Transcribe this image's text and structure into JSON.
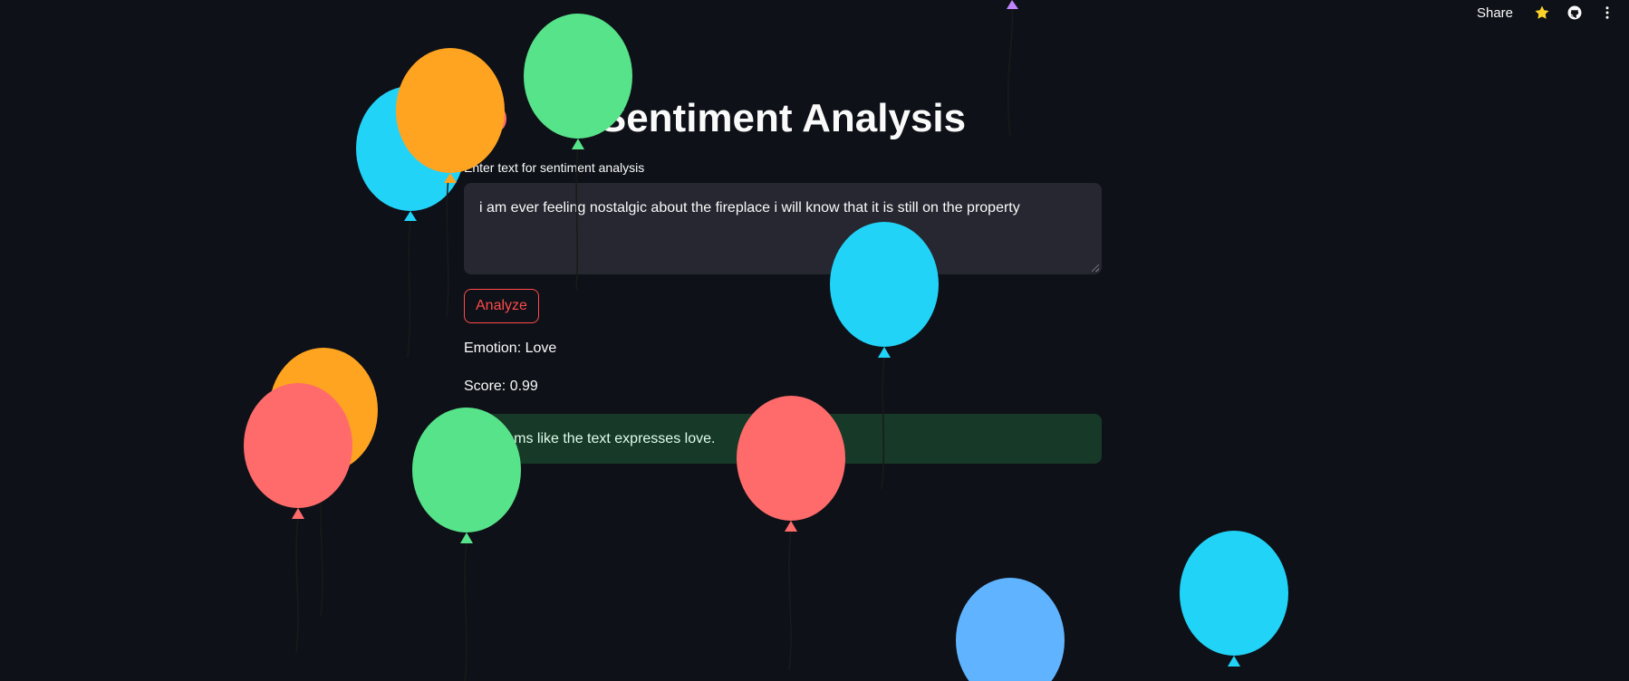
{
  "toolbar": {
    "share_label": "Share",
    "star_icon": "star-icon",
    "github_icon": "github-icon",
    "menu_icon": "more-vertical-icon"
  },
  "main": {
    "title": "Sentiment Analysis",
    "input_label": "Enter text for sentiment analysis",
    "input_value": "i am ever feeling nostalgic about the fireplace i will know that it is still on the property",
    "analyze_label": "Analyze",
    "emotion_text": "Emotion: Love",
    "score_text": "Score: 0.99",
    "alert_text": "It seems like the text expresses love."
  },
  "colors": {
    "background": "#0e1117",
    "accent": "#ff4b4b",
    "input_bg": "#262730",
    "success_bg": "#173928",
    "star": "#fdd32a",
    "balloon_blue": "#22d3f8",
    "balloon_orange": "#ffa421",
    "balloon_green": "#57e389",
    "balloon_red": "#ff6b6b",
    "balloon_sky": "#60b4ff",
    "balloon_purple": "#c084fc"
  }
}
